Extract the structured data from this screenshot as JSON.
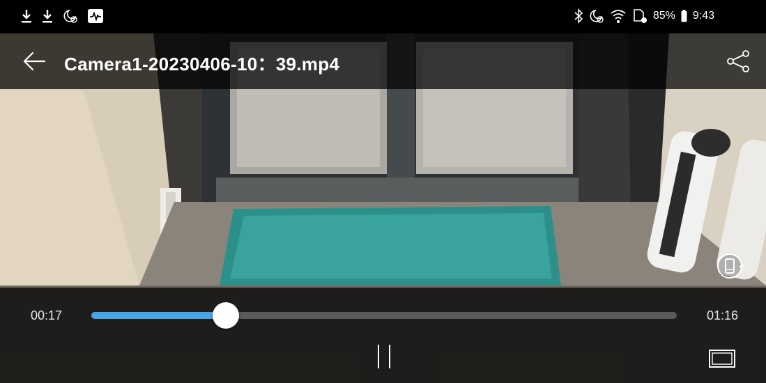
{
  "status_bar": {
    "left_icons": [
      "download-icon",
      "download-icon",
      "do-not-disturb-alarm-icon",
      "activity-monitor-icon"
    ],
    "right_icons": [
      "bluetooth-icon",
      "do-not-disturb-alarm-icon",
      "wifi-icon",
      "sim-card-icon",
      "battery-icon"
    ],
    "battery_text": "85%",
    "clock": "9:43"
  },
  "title_bar": {
    "title": "Camera1-20230406-10：39.mp4"
  },
  "player": {
    "elapsed": "00:17",
    "total": "01:16",
    "progress_fraction": 0.23,
    "accent_color": "#4aa4e8",
    "track_color": "#5a5a5a"
  }
}
